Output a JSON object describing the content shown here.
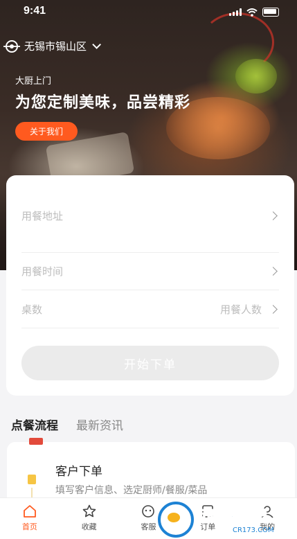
{
  "status_bar": {
    "time": "9:41"
  },
  "header": {
    "location": "无锡市锡山区",
    "subtitle": "大厨上门",
    "title": "为您定制美味，品尝精彩",
    "about_button": "关于我们"
  },
  "order_form": {
    "address_placeholder": "用餐地址",
    "time_placeholder": "用餐时间",
    "tables_label": "桌数",
    "people_placeholder": "用餐人数",
    "start_button": "开始下单"
  },
  "section_tabs": [
    "点餐流程",
    "最新资讯"
  ],
  "process_step": {
    "title": "客户下单",
    "description": "填写客户信息、选定厨师/餐服/菜品"
  },
  "tabbar": {
    "items": [
      {
        "label": "首页",
        "icon": "home-icon",
        "active": true
      },
      {
        "label": "收藏",
        "icon": "star-icon",
        "active": false
      },
      {
        "label": "客服",
        "icon": "chat-icon",
        "active": false
      },
      {
        "label": "订单",
        "icon": "order-icon",
        "active": false
      },
      {
        "label": "我的",
        "icon": "profile-icon",
        "active": false
      }
    ]
  },
  "watermark": {
    "main": "西西软件园",
    "sub": "CR173.COM"
  },
  "colors": {
    "accent": "#ff5a1f",
    "button_disabled": "#ebebeb"
  }
}
